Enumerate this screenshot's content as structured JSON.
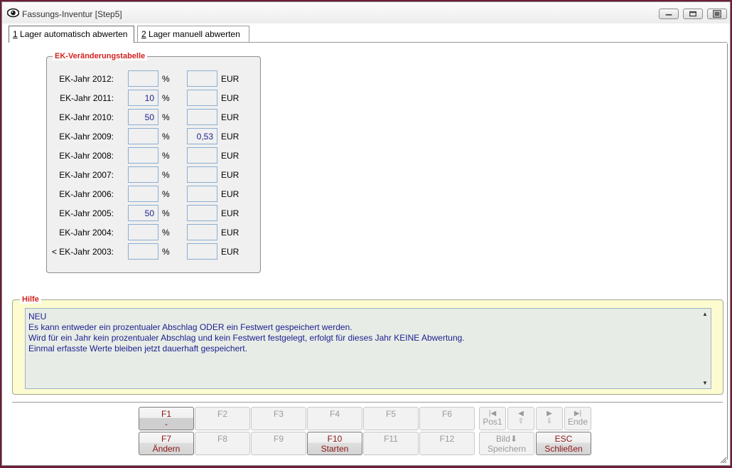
{
  "window": {
    "title": "Fassungs-Inventur [Step5]",
    "icon": "eye-icon",
    "controls": [
      "minimize-icon",
      "maximize-icon",
      "close-icon"
    ]
  },
  "tabs": [
    {
      "key": "1",
      "label": " Lager automatisch abwerten",
      "selected": true
    },
    {
      "key": "2",
      "label": " Lager manuell abwerten",
      "selected": false
    }
  ],
  "ek_table": {
    "title": "EK-Veränderungstabelle",
    "pct_unit": "%",
    "eur_unit": "EUR",
    "rows": [
      {
        "label": "EK-Jahr 2012:",
        "pct": "",
        "eur": ""
      },
      {
        "label": "EK-Jahr 2011:",
        "pct": "10",
        "eur": ""
      },
      {
        "label": "EK-Jahr 2010:",
        "pct": "50",
        "eur": ""
      },
      {
        "label": "EK-Jahr 2009:",
        "pct": "",
        "eur": "0,53"
      },
      {
        "label": "EK-Jahr 2008:",
        "pct": "",
        "eur": ""
      },
      {
        "label": "EK-Jahr 2007:",
        "pct": "",
        "eur": ""
      },
      {
        "label": "EK-Jahr 2006:",
        "pct": "",
        "eur": ""
      },
      {
        "label": "EK-Jahr 2005:",
        "pct": "50",
        "eur": ""
      },
      {
        "label": "EK-Jahr 2004:",
        "pct": "",
        "eur": ""
      },
      {
        "label": "< EK-Jahr 2003:",
        "pct": "",
        "eur": ""
      }
    ]
  },
  "help": {
    "title": "Hilfe",
    "lines": [
      "NEU",
      "Es kann entweder ein prozentualer Abschlag ODER ein Festwert gespeichert werden.",
      "Wird für ein Jahr kein prozentualer Abschlag und kein Festwert festgelegt, erfolgt für dieses Jahr KEINE Abwertung.",
      "Einmal erfasste Werte bleiben jetzt dauerhaft gespeichert."
    ]
  },
  "function_keys": {
    "row1": [
      {
        "key": "F1",
        "desc": "-",
        "enabled": true
      },
      {
        "key": "F2",
        "desc": "",
        "enabled": false
      },
      {
        "key": "F3",
        "desc": "",
        "enabled": false
      },
      {
        "key": "F4",
        "desc": "",
        "enabled": false
      },
      {
        "key": "F5",
        "desc": "",
        "enabled": false
      },
      {
        "key": "F6",
        "desc": "",
        "enabled": false
      }
    ],
    "row2": [
      {
        "key": "F7",
        "desc": "Ändern",
        "enabled": true
      },
      {
        "key": "F8",
        "desc": "",
        "enabled": false
      },
      {
        "key": "F9",
        "desc": "",
        "enabled": false
      },
      {
        "key": "F10",
        "desc": "Starten",
        "enabled": true
      },
      {
        "key": "F11",
        "desc": "",
        "enabled": false
      },
      {
        "key": "F12",
        "desc": "",
        "enabled": false
      }
    ]
  },
  "navigation": {
    "pos1": {
      "label": "Pos1",
      "icon": "first-record-icon"
    },
    "up": {
      "label": "",
      "icon": "previous-record-icon"
    },
    "down": {
      "label": "",
      "icon": "next-record-icon"
    },
    "end": {
      "label": "Ende",
      "icon": "last-record-icon"
    },
    "page": {
      "label": "Bild",
      "desc": "Speichern",
      "icon": "page-down-arrow-icon"
    },
    "esc": {
      "key": "ESC",
      "desc": "Schließen"
    }
  },
  "colors": {
    "field_value": "#1d1d8f",
    "legend": "#d42020",
    "help_background": "#fdfcd0",
    "function_key_text": "#8a1414",
    "outer_frame": "#6e1d36"
  }
}
